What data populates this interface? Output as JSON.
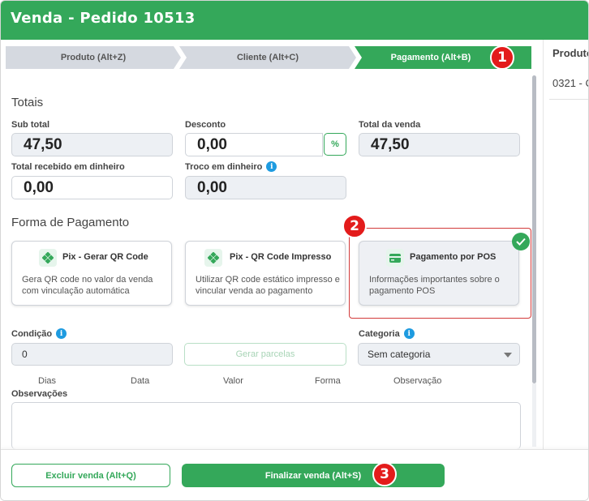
{
  "header": {
    "title": "Venda - Pedido 10513"
  },
  "steps": [
    {
      "label": "Produto (Alt+Z)"
    },
    {
      "label": "Cliente (Alt+C)"
    },
    {
      "label": "Pagamento (Alt+B)"
    }
  ],
  "badges": {
    "b1": "1",
    "b2": "2",
    "b3": "3"
  },
  "totais": {
    "title": "Totais",
    "sub_total_label": "Sub total",
    "sub_total_value": "47,50",
    "desconto_label": "Desconto",
    "desconto_value": "0,00",
    "percent_label": "%",
    "total_venda_label": "Total da venda",
    "total_venda_value": "47,50",
    "recebido_label": "Total recebido em dinheiro",
    "recebido_value": "0,00",
    "troco_label": "Troco em dinheiro",
    "troco_value": "0,00"
  },
  "forma": {
    "title": "Forma de Pagamento",
    "cards": [
      {
        "title": "Pix - Gerar QR Code",
        "desc": "Gera QR code no valor da venda com vinculação automática"
      },
      {
        "title": "Pix - QR Code Impresso",
        "desc": "Utilizar QR code estático impresso e vincular venda ao pagamento"
      },
      {
        "title": "Pagamento por POS",
        "desc": "Informações importantes sobre o pagamento POS"
      }
    ]
  },
  "condicao": {
    "label": "Condição",
    "value": "0",
    "gerar_label": "Gerar parcelas"
  },
  "categoria": {
    "label": "Categoria",
    "value": "Sem categoria"
  },
  "parcelas_columns": [
    "Dias",
    "Data",
    "Valor",
    "Forma",
    "Observação"
  ],
  "observacoes": {
    "label": "Observações"
  },
  "side": {
    "header": "Produto",
    "row": "0321 - C"
  },
  "footer": {
    "excluir_label": "Excluir venda (Alt+Q)",
    "finalizar_label": "Finalizar venda (Alt+S)"
  },
  "colors": {
    "brand": "#34a85a",
    "badge": "#e31b1b",
    "info": "#1e9be0"
  }
}
